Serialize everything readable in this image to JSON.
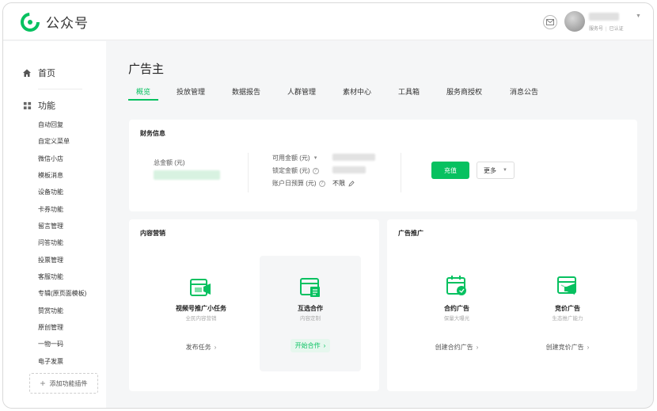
{
  "app": {
    "name": "公众号"
  },
  "header": {
    "account_type": "服务号",
    "account_status": "已认证"
  },
  "sidebar": {
    "home_label": "首页",
    "features_label": "功能",
    "items": [
      "自动回复",
      "自定义菜单",
      "微信小店",
      "模板消息",
      "设备功能",
      "卡券功能",
      "留言管理",
      "问答功能",
      "投票管理",
      "客服功能",
      "专辑(原页面模板)",
      "赞赏功能",
      "原创管理",
      "一物一码",
      "电子发票"
    ],
    "add_plugin_label": "添加功能插件"
  },
  "page": {
    "title": "广告主",
    "tabs": [
      "概览",
      "投放管理",
      "数据报告",
      "人群管理",
      "素材中心",
      "工具箱",
      "服务商授权",
      "消息公告"
    ],
    "active_tab": 0
  },
  "finance": {
    "title": "财务信息",
    "total_label": "总金额 (元)",
    "available_label": "可用金额 (元)",
    "locked_label": "锁定金额 (元)",
    "daily_budget_label": "账户日预算 (元)",
    "daily_budget_value": "不限",
    "recharge_label": "充值",
    "more_label": "更多"
  },
  "content_marketing": {
    "title": "内容营销",
    "tiles": [
      {
        "title": "视频号推广小任务",
        "subtitle": "全民内容营销",
        "action": "发布任务"
      },
      {
        "title": "互选合作",
        "subtitle": "内容定制",
        "action": "开始合作"
      }
    ]
  },
  "ad_promotion": {
    "title": "广告推广",
    "tiles": [
      {
        "title": "合约广告",
        "subtitle": "保量大曝光",
        "action": "创建合约广告"
      },
      {
        "title": "竞价广告",
        "subtitle": "生态推广能力",
        "action": "创建竞价广告"
      }
    ]
  },
  "colors": {
    "accent": "#07c160",
    "accent_light": "#e6f7ee"
  }
}
